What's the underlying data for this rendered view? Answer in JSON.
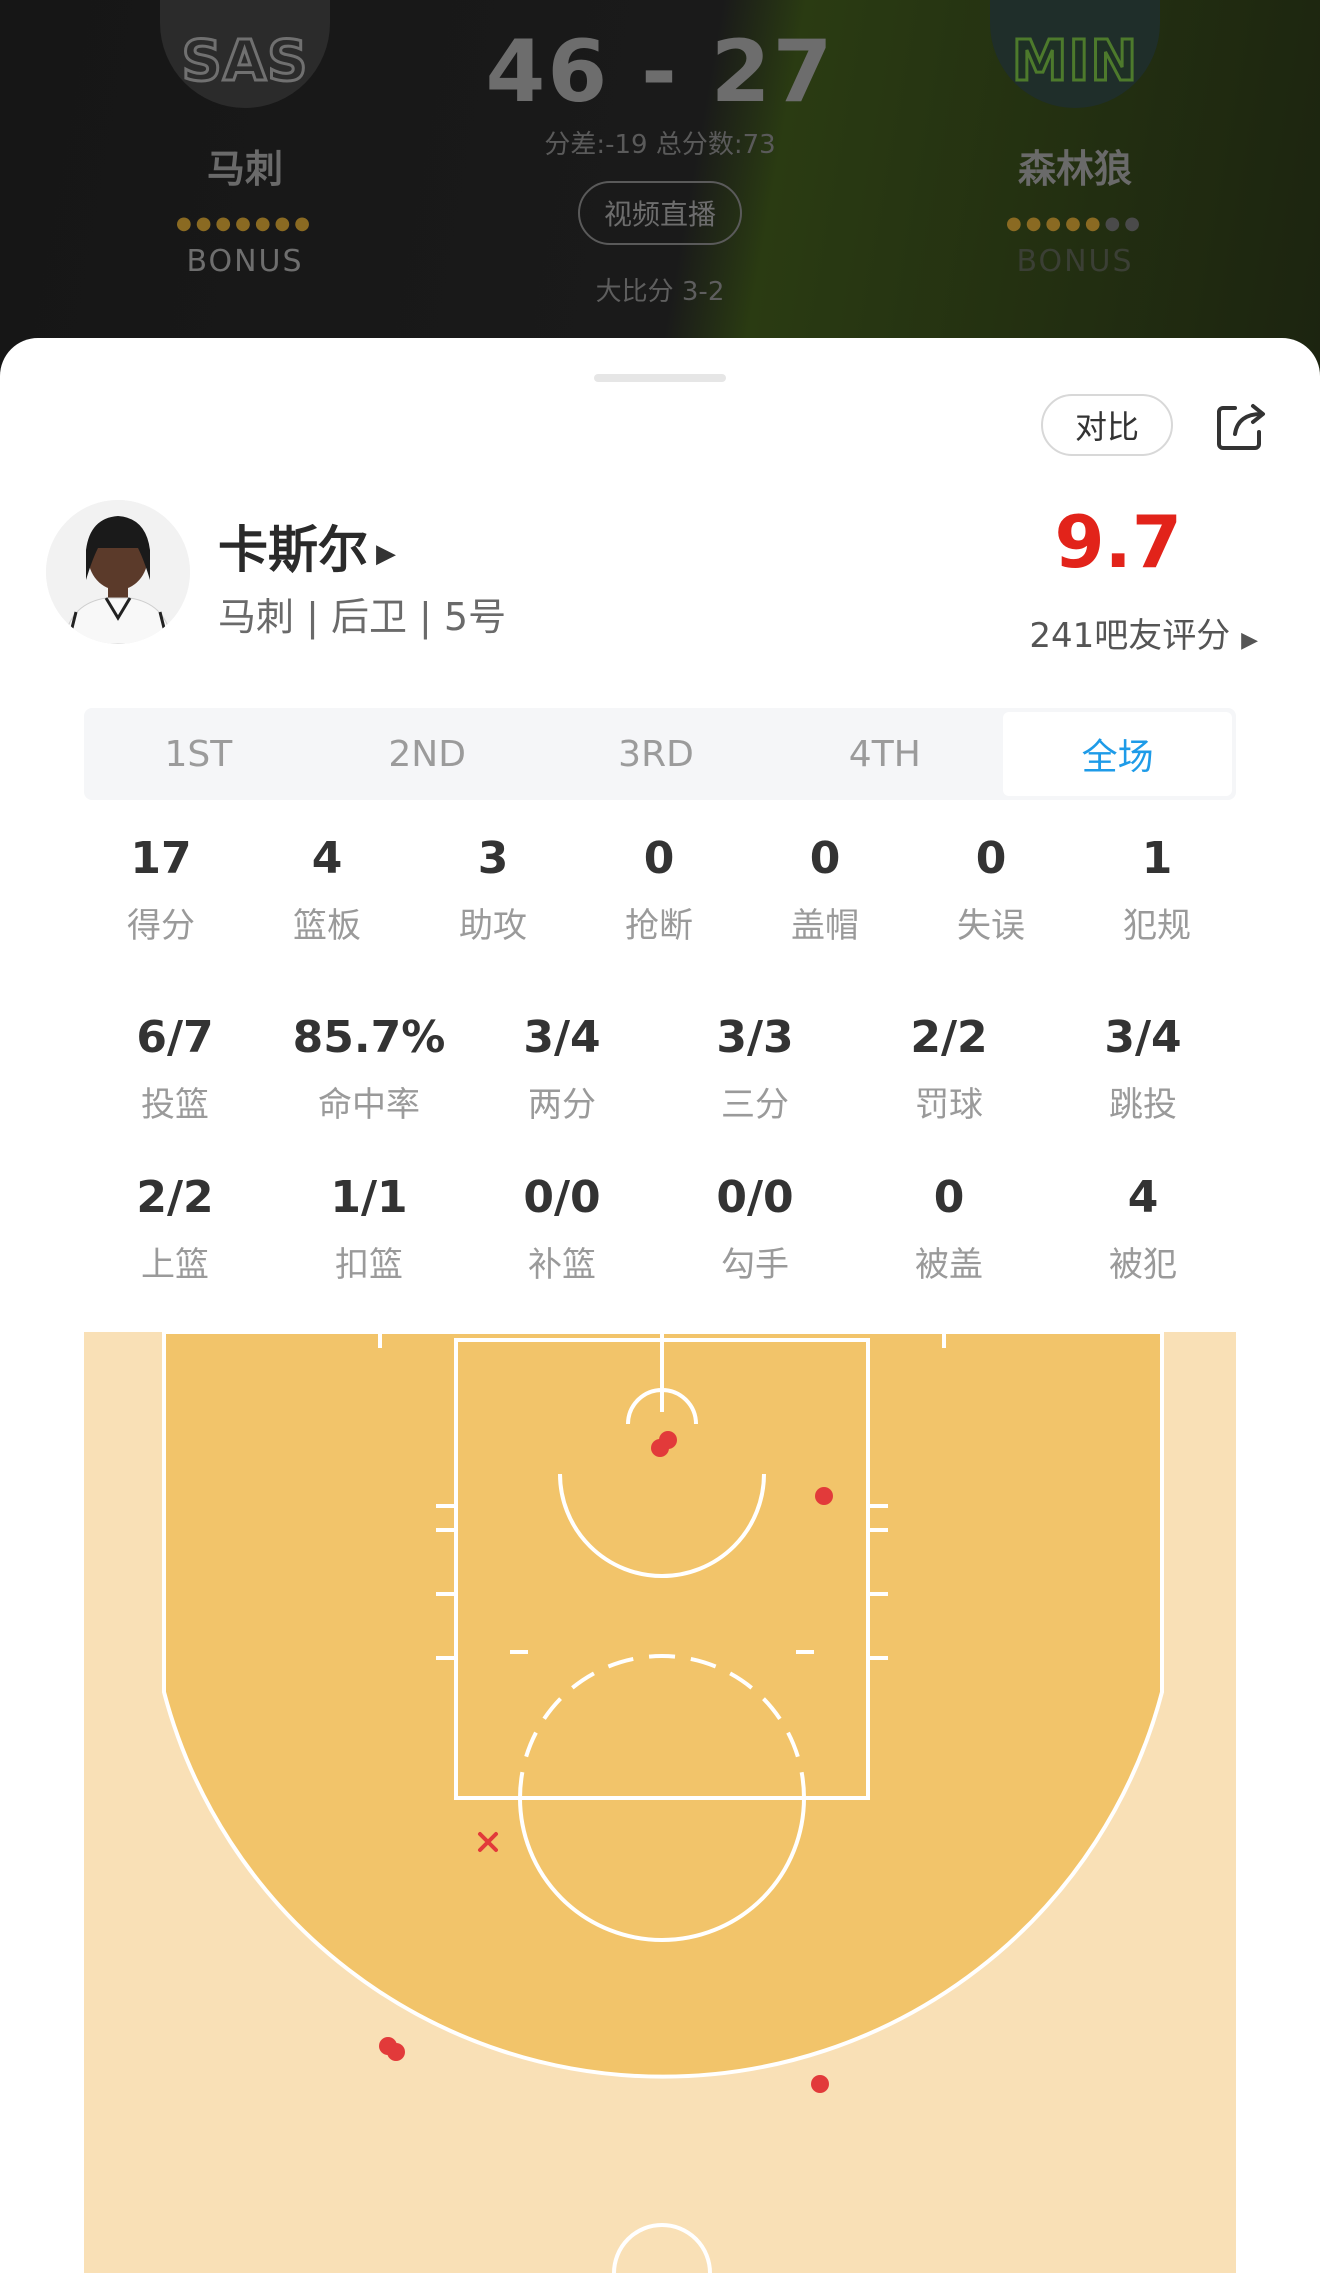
{
  "header": {
    "home": {
      "logo_text": "SAS",
      "name": "马刺",
      "bonus": "BONUS"
    },
    "away": {
      "logo_text": "MIN",
      "name": "森林狼",
      "bonus": "BONUS"
    },
    "score": "46 - 27",
    "diff": "分差:-19 总分数:73",
    "video_button": "视频直播",
    "series": "大比分 3-2"
  },
  "actions": {
    "compare_label": "对比"
  },
  "player": {
    "name": "卡斯尔",
    "info": "马刺 | 后卫 | 5号",
    "rating": "9.7",
    "rating_count": "241吧友评分"
  },
  "tabs": [
    "1ST",
    "2ND",
    "3RD",
    "4TH",
    "全场"
  ],
  "stats_main": [
    {
      "value": "17",
      "label": "得分"
    },
    {
      "value": "4",
      "label": "篮板"
    },
    {
      "value": "3",
      "label": "助攻"
    },
    {
      "value": "0",
      "label": "抢断"
    },
    {
      "value": "0",
      "label": "盖帽"
    },
    {
      "value": "0",
      "label": "失误"
    },
    {
      "value": "1",
      "label": "犯规"
    }
  ],
  "stats_shooting": [
    {
      "value": "6/7",
      "label": "投篮"
    },
    {
      "value": "85.7%",
      "label": "命中率"
    },
    {
      "value": "3/4",
      "label": "两分"
    },
    {
      "value": "3/3",
      "label": "三分"
    },
    {
      "value": "2/2",
      "label": "罚球"
    },
    {
      "value": "3/4",
      "label": "跳投"
    }
  ],
  "stats_types": [
    {
      "value": "2/2",
      "label": "上篮"
    },
    {
      "value": "1/1",
      "label": "扣篮"
    },
    {
      "value": "0/0",
      "label": "补篮"
    },
    {
      "value": "0/0",
      "label": "勾手"
    },
    {
      "value": "0",
      "label": "被盖"
    },
    {
      "value": "4",
      "label": "被犯"
    }
  ],
  "colors": {
    "accent": "#1e9be8",
    "rating": "#e2231a",
    "court_paint": "#f2c46a",
    "court_outer": "#f9e0b6",
    "shot_made": "#e23a3a"
  }
}
